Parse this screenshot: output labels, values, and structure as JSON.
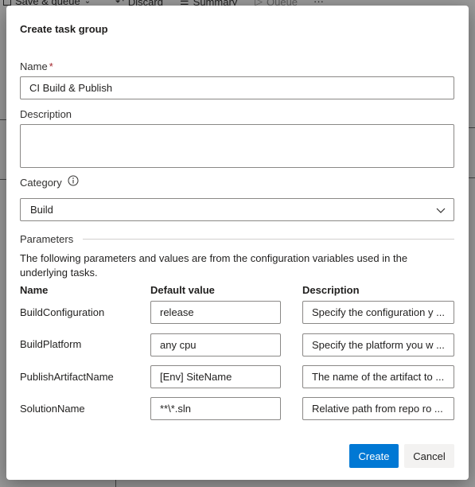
{
  "background": {
    "toolbar": {
      "save_queue": "Save & queue",
      "discard": "Discard",
      "summary": "Summary",
      "queue": "Queue",
      "more": "···"
    }
  },
  "dialog": {
    "title": "Create task group",
    "name_label": "Name",
    "required_marker": "*",
    "name_value": "CI Build & Publish",
    "description_label": "Description",
    "description_value": "",
    "category_label": "Category",
    "category_value": "Build",
    "parameters_heading": "Parameters",
    "parameters_text": "The following parameters and values are from the configuration variables used in the underlying tasks.",
    "columns": {
      "name": "Name",
      "default_value": "Default value",
      "description": "Description"
    },
    "parameters": [
      {
        "name": "BuildConfiguration",
        "default": "release",
        "description": "Specify the configuration y ..."
      },
      {
        "name": "BuildPlatform",
        "default": "any cpu",
        "description": "Specify the platform you w ..."
      },
      {
        "name": "PublishArtifactName",
        "default": "[Env] SiteName",
        "description": "The name of the artifact to ..."
      },
      {
        "name": "SolutionName",
        "default": "**\\*.sln",
        "description": "Relative path from repo ro ..."
      }
    ],
    "create_button": "Create",
    "cancel_button": "Cancel"
  },
  "colors": {
    "primary": "#0078d4",
    "required": "#a4262c",
    "border": "#8a8886",
    "secondary_button": "#f3f2f1"
  }
}
